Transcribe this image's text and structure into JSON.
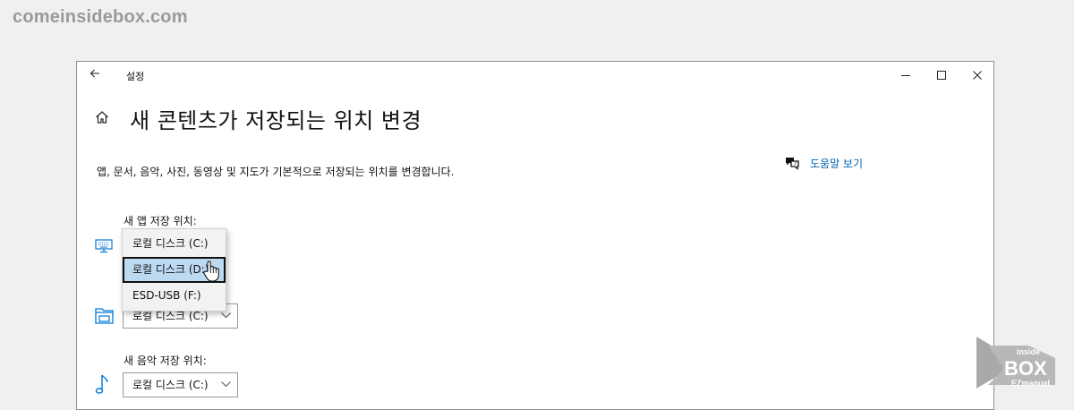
{
  "watermark": "comeinsidebox.com",
  "window": {
    "title": "설정",
    "page_title": "새 콘텐츠가 저장되는 위치 변경",
    "description": "앱, 문서, 음악, 사진, 동영상 및 지도가 기본적으로 저장되는 위치를 변경합니다.",
    "help_link": "도움말 보기",
    "sections": [
      {
        "label": "새 앱 저장 위치:",
        "icon": "monitor-icon",
        "value": "로컬 디스크 (C:)"
      },
      {
        "label": "",
        "icon": "folder-icon",
        "value": "로컬 디스크 (C:)"
      },
      {
        "label": "새 음악 저장 위치:",
        "icon": "music-note-icon",
        "value": "로컬 디스크 (C:)"
      }
    ],
    "dropdown_options": [
      "로컬 디스크 (C:)",
      "로컬 디스크 (D:)",
      "ESD-USB (F:)"
    ],
    "dropdown_selected_index": 1
  },
  "logo": {
    "line1": "inside",
    "line2": "BOX",
    "line3": "EZmanual"
  },
  "colors": {
    "link": "#0063b1",
    "icon_blue": "#0078d7",
    "selected_bg": "#bcd9f2"
  }
}
